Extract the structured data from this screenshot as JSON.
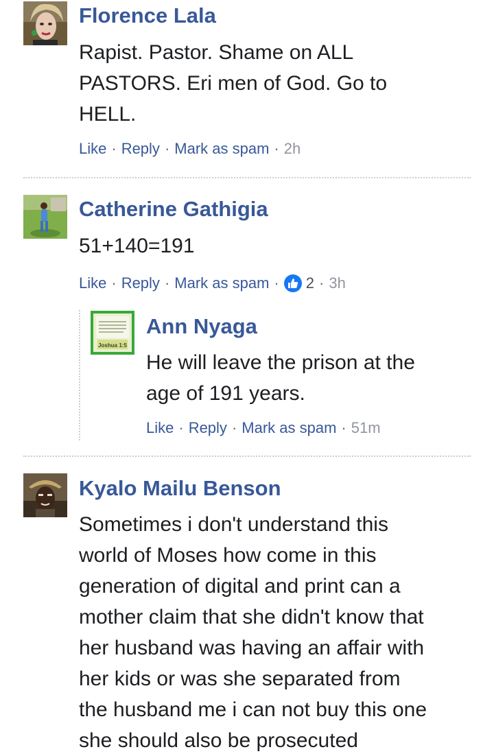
{
  "comments": [
    {
      "author": "Florence Lala",
      "text": "Rapist. Pastor. Shame on ALL\nPASTORS. Eri men of God. Go to\nHELL.",
      "actions": {
        "like": "Like",
        "reply": "Reply",
        "spam": "Mark as spam",
        "time": "2h"
      }
    },
    {
      "author": "Catherine Gathigia",
      "text": "51+140=191",
      "actions": {
        "like": "Like",
        "reply": "Reply",
        "spam": "Mark as spam",
        "reactions": "2",
        "time": "3h"
      },
      "reply": {
        "author": "Ann Nyaga",
        "avatar_text_top": "Joshua 1:9",
        "avatar_text_bottom": "Joshua 1:5",
        "text": "He will leave the prison at the\nage of 191 years.",
        "actions": {
          "like": "Like",
          "reply": "Reply",
          "spam": "Mark as spam",
          "time": "51m"
        }
      }
    },
    {
      "author": "Kyalo Mailu Benson",
      "text": "Sometimes i don't understand this\nworld of Moses how come in this\ngeneration of digital and print can a\nmother claim that she didn't know that\nher husband was having an affair with\nher kids or was she separated from\nthe husband me i can not buy this one\nshe should also be prosecuted"
    }
  ],
  "separator": "·",
  "colors": {
    "author": "#385898",
    "link": "#385898",
    "time": "#90949c",
    "like_badge": "#1877f2",
    "divider": "#c8ccd2"
  }
}
